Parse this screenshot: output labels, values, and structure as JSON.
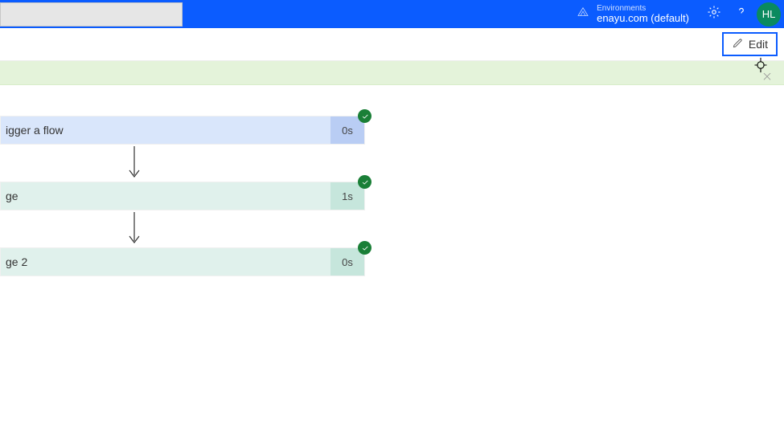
{
  "header": {
    "search_placeholder": "",
    "env_label": "Environments",
    "env_name": "enayu.com (default)",
    "avatar_initials": "HL"
  },
  "toolbar": {
    "edit_label": "Edit"
  },
  "banner": {},
  "flow": {
    "steps": [
      {
        "kind": "trigger",
        "label": "igger a flow",
        "duration": "0s",
        "status": "success"
      },
      {
        "kind": "action",
        "label": "ge",
        "duration": "1s",
        "status": "success"
      },
      {
        "kind": "action",
        "label": "ge 2",
        "duration": "0s",
        "status": "success"
      }
    ]
  }
}
